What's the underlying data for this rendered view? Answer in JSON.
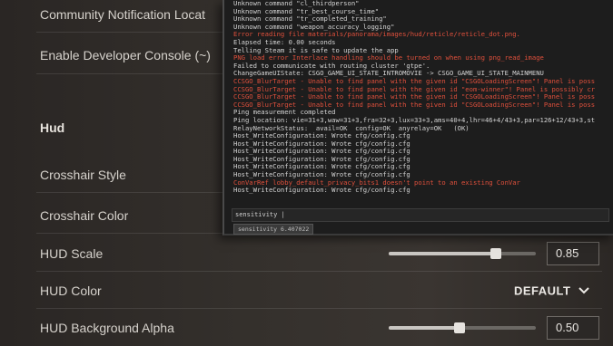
{
  "settings": {
    "rows": [
      {
        "label": "Community Notification Locat"
      },
      {
        "label": "Enable Developer Console (~)"
      },
      {
        "label": "Hud"
      },
      {
        "label": "Crosshair Style"
      },
      {
        "label": "Crosshair Color"
      },
      {
        "label": "HUD Scale",
        "value": "0.85",
        "slider_fraction": 0.73
      },
      {
        "label": "HUD Color",
        "dropdown": "DEFAULT"
      },
      {
        "label": "HUD Background Alpha",
        "value": "0.50",
        "slider_fraction": 0.48
      }
    ],
    "dropdown_icon": "chevron-down-icon"
  },
  "console": {
    "lines": [
      {
        "text": "Unknown command \"cl_thirdperson\"",
        "error": false
      },
      {
        "text": "Unknown command \"tr_best_course_time\"",
        "error": false
      },
      {
        "text": "Unknown command \"tr_completed_training\"",
        "error": false
      },
      {
        "text": "Unknown command \"weapon_accuracy_logging\"",
        "error": false
      },
      {
        "text": "Error reading file materials/panorama/images/hud/reticle/reticle_dot.png.",
        "error": true
      },
      {
        "text": "Elapsed time: 0.00 seconds",
        "error": false
      },
      {
        "text": "Telling Steam it is safe to update the app",
        "error": false
      },
      {
        "text": "PNG load error Interlace handling should be turned on when using png_read_image",
        "error": true
      },
      {
        "text": "Failed to communicate with routing cluster 'gtpe'.",
        "error": false
      },
      {
        "text": "ChangeGameUIState: CSGO_GAME_UI_STATE_INTROMOVIE -> CSGO_GAME_UI_STATE_MAINMENU",
        "error": false
      },
      {
        "text": "CCSGO_BlurTarget - Unable to find panel with the given id \"CSGOLoadingScreen\"! Panel is poss",
        "error": true
      },
      {
        "text": "CCSGO_BlurTarget - Unable to find panel with the given id \"eom-winner\"! Panel is possibly cr",
        "error": true
      },
      {
        "text": "CCSGO_BlurTarget - Unable to find panel with the given id \"CSGOLoadingScreen\"! Panel is poss",
        "error": true
      },
      {
        "text": "CCSGO_BlurTarget - Unable to find panel with the given id \"CSGOLoadingScreen\"! Panel is poss",
        "error": true
      },
      {
        "text": "Ping measurement completed",
        "error": false
      },
      {
        "text": "Ping location: vie=31+3,waw=31+3,fra=32+3,lux=33+3,ams=40+4,lhr=46+4/43+3,par=126+12/43+3,st",
        "error": false
      },
      {
        "text": "RelayNetworkStatus:  avail=OK  config=OK  anyrelay=OK   (OK)",
        "error": false
      },
      {
        "text": "Host_WriteConfiguration: Wrote cfg/config.cfg",
        "error": false
      },
      {
        "text": "Host_WriteConfiguration: Wrote cfg/config.cfg",
        "error": false
      },
      {
        "text": "Host_WriteConfiguration: Wrote cfg/config.cfg",
        "error": false
      },
      {
        "text": "Host_WriteConfiguration: Wrote cfg/config.cfg",
        "error": false
      },
      {
        "text": "Host_WriteConfiguration: Wrote cfg/config.cfg",
        "error": false
      },
      {
        "text": "Host_WriteConfiguration: Wrote cfg/config.cfg",
        "error": false
      },
      {
        "text": "ConVarRef lobby_default_privacy_bits1 doesn't point to an existing ConVar",
        "error": true
      },
      {
        "text": "Host_WriteConfiguration: Wrote cfg/config.cfg",
        "error": false
      }
    ],
    "input_value": "sensitivity |",
    "autocomplete": "sensitivity 6.407022",
    "error_color": "#e0503c"
  }
}
